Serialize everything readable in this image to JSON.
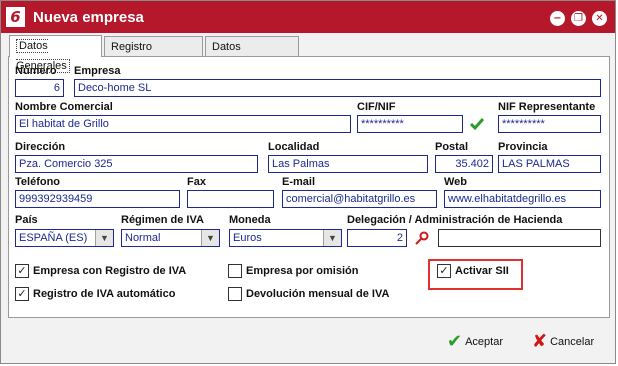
{
  "window": {
    "app_logo": "6",
    "title": "Nueva empresa",
    "min_glyph": "−",
    "max_glyph": "❐",
    "close_glyph": "✕"
  },
  "tabs": [
    "Datos Generales",
    "Registro Mercantil",
    "Datos Bancarios"
  ],
  "fields": {
    "numero": {
      "label": "Número",
      "value": "6"
    },
    "empresa": {
      "label": "Empresa",
      "value": "Deco-home SL"
    },
    "nombre_comercial": {
      "label": "Nombre Comercial",
      "value": "El habitat de Grillo"
    },
    "cif": {
      "label": "CIF/NIF",
      "value": "**********"
    },
    "nif_representante": {
      "label": "NIF Representante",
      "value": "**********"
    },
    "direccion": {
      "label": "Dirección",
      "value": "Pza. Comercio 325"
    },
    "localidad": {
      "label": "Localidad",
      "value": "Las Palmas"
    },
    "postal": {
      "label": "Postal",
      "value": "35.402"
    },
    "provincia": {
      "label": "Provincia",
      "value": "LAS PALMAS"
    },
    "telefono": {
      "label": "Teléfono",
      "value": "999392939459"
    },
    "fax": {
      "label": "Fax",
      "value": ""
    },
    "email": {
      "label": "E-mail",
      "value": "comercial@habitatgrillo.es"
    },
    "web": {
      "label": "Web",
      "value": "www.elhabitatdegrillo.es"
    },
    "pais": {
      "label": "País",
      "value": "ESPAÑA  (ES)"
    },
    "regimen_iva": {
      "label": "Régimen de IVA",
      "value": "Normal"
    },
    "moneda": {
      "label": "Moneda",
      "value": "Euros"
    },
    "delegacion": {
      "label": "Delegación / Administración de Hacienda",
      "value": "2",
      "name_value": ""
    }
  },
  "checkboxes": {
    "registro_iva": {
      "label": "Empresa con Registro de IVA",
      "checked": true
    },
    "por_omision": {
      "label": "Empresa por omisión",
      "checked": false
    },
    "activar_sii": {
      "label": "Activar SII",
      "checked": true
    },
    "registro_iva_auto": {
      "label": "Registro de IVA automático",
      "checked": true
    },
    "devolucion_mensual": {
      "label": "Devolución mensual de IVA",
      "checked": false
    }
  },
  "buttons": {
    "accept_label": "Aceptar",
    "cancel_label": "Cancelar"
  },
  "colors": {
    "titlebar": "#b5172b",
    "field_border": "#1c2a8f",
    "highlight": "#e03030",
    "valid_check": "#2a9d2a"
  }
}
